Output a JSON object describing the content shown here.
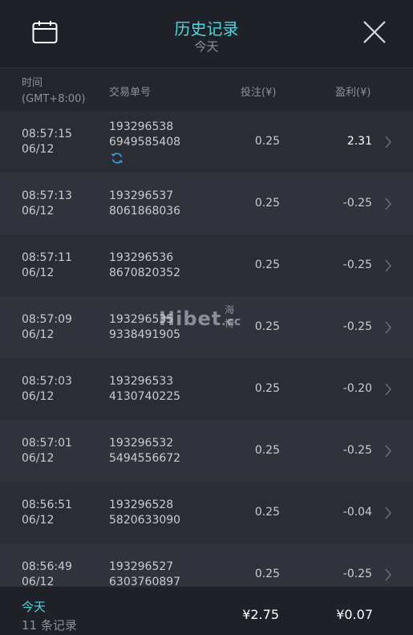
{
  "header": {
    "title": "历史记录",
    "subtitle": "今天",
    "calendar_icon": "calendar-icon",
    "close_icon": "close-icon"
  },
  "columns": {
    "time": "时间",
    "timezone": "(GMT+8:00)",
    "txn": "交易单号",
    "bet": "投注(¥)",
    "pnl": "盈利(¥)"
  },
  "rows": [
    {
      "time": "08:57:15",
      "date": "06/12",
      "txn1": "193296538",
      "txn2": "6949585408",
      "bet": "0.25",
      "pnl": "2.31",
      "pending": true
    },
    {
      "time": "08:57:13",
      "date": "06/12",
      "txn1": "193296537",
      "txn2": "8061868036",
      "bet": "0.25",
      "pnl": "-0.25"
    },
    {
      "time": "08:57:11",
      "date": "06/12",
      "txn1": "193296536",
      "txn2": "8670820352",
      "bet": "0.25",
      "pnl": "-0.25"
    },
    {
      "time": "08:57:09",
      "date": "06/12",
      "txn1": "193296535",
      "txn2": "9338491905",
      "bet": "0.25",
      "pnl": "-0.25"
    },
    {
      "time": "08:57:03",
      "date": "06/12",
      "txn1": "193296533",
      "txn2": "4130740225",
      "bet": "0.25",
      "pnl": "-0.20"
    },
    {
      "time": "08:57:01",
      "date": "06/12",
      "txn1": "193296532",
      "txn2": "5494556672",
      "bet": "0.25",
      "pnl": "-0.25"
    },
    {
      "time": "08:56:51",
      "date": "06/12",
      "txn1": "193296528",
      "txn2": "5820633090",
      "bet": "0.25",
      "pnl": "-0.04"
    },
    {
      "time": "08:56:49",
      "date": "06/12",
      "txn1": "193296527",
      "txn2": "6303760897",
      "bet": "0.25",
      "pnl": "-0.25"
    }
  ],
  "footer": {
    "period": "今天",
    "count": "11 条记录",
    "total_bet": "¥2.75",
    "total_pnl": "¥0.07"
  },
  "watermark": {
    "brand": "Hibet",
    "suffix": ".cc",
    "cn": "海博"
  },
  "colors": {
    "accent": "#4fd6df",
    "background": "#24262e",
    "header": "#1f2128"
  }
}
